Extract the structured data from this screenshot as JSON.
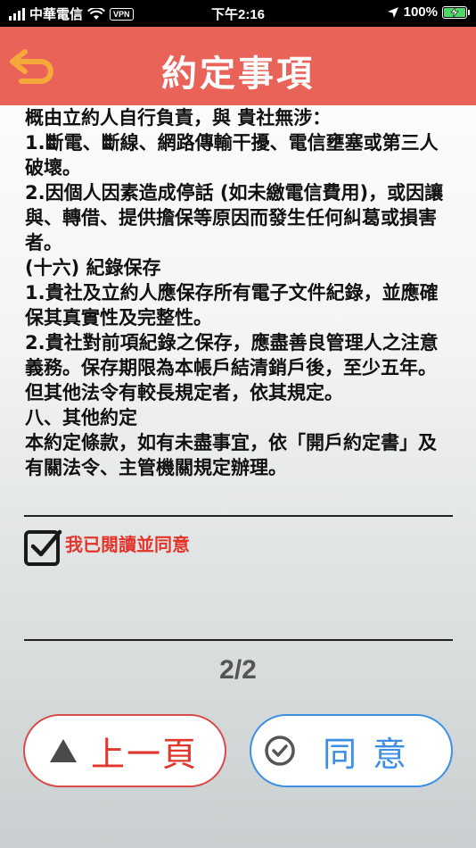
{
  "status_bar": {
    "carrier": "中華電信",
    "vpn": "VPN",
    "time": "下午2:16",
    "battery": "100%",
    "battery_level": 1.0
  },
  "header": {
    "title": "約定事項",
    "back_icon": "return-arrow-icon"
  },
  "content": {
    "paragraphs": [
      "概由立約人自行負責，與 貴社無涉：",
      "1.斷電、斷線、網路傳輸干擾、電信壅塞或第三人破壞。",
      "2.因個人因素造成停話 (如未繳電信費用)，或因讓與、轉借、提供擔保等原因而發生任何糾葛或損害者。",
      "(十六) 紀錄保存",
      "1.貴社及立約人應保存所有電子文件紀錄，並應確保其真實性及完整性。",
      "2.貴社對前項紀錄之保存，應盡善良管理人之注意義務。保存期限為本帳戶結清銷戶後，至少五年。但其他法令有較長規定者，依其規定。",
      "八、其他約定",
      "本約定條款，如有未盡事宜，依「開戶約定書」及有關法令、主管機關規定辦理。"
    ]
  },
  "agreement": {
    "checked": true,
    "label": "我已閱讀並同意"
  },
  "pagination": {
    "indicator": "2/2"
  },
  "buttons": {
    "prev_label": "上一頁",
    "agree_label": "同意"
  },
  "colors": {
    "header_bg": "#e96358",
    "accent_red": "#e2352b",
    "accent_blue": "#3d8fe6",
    "back_icon": "#f4a93a"
  }
}
